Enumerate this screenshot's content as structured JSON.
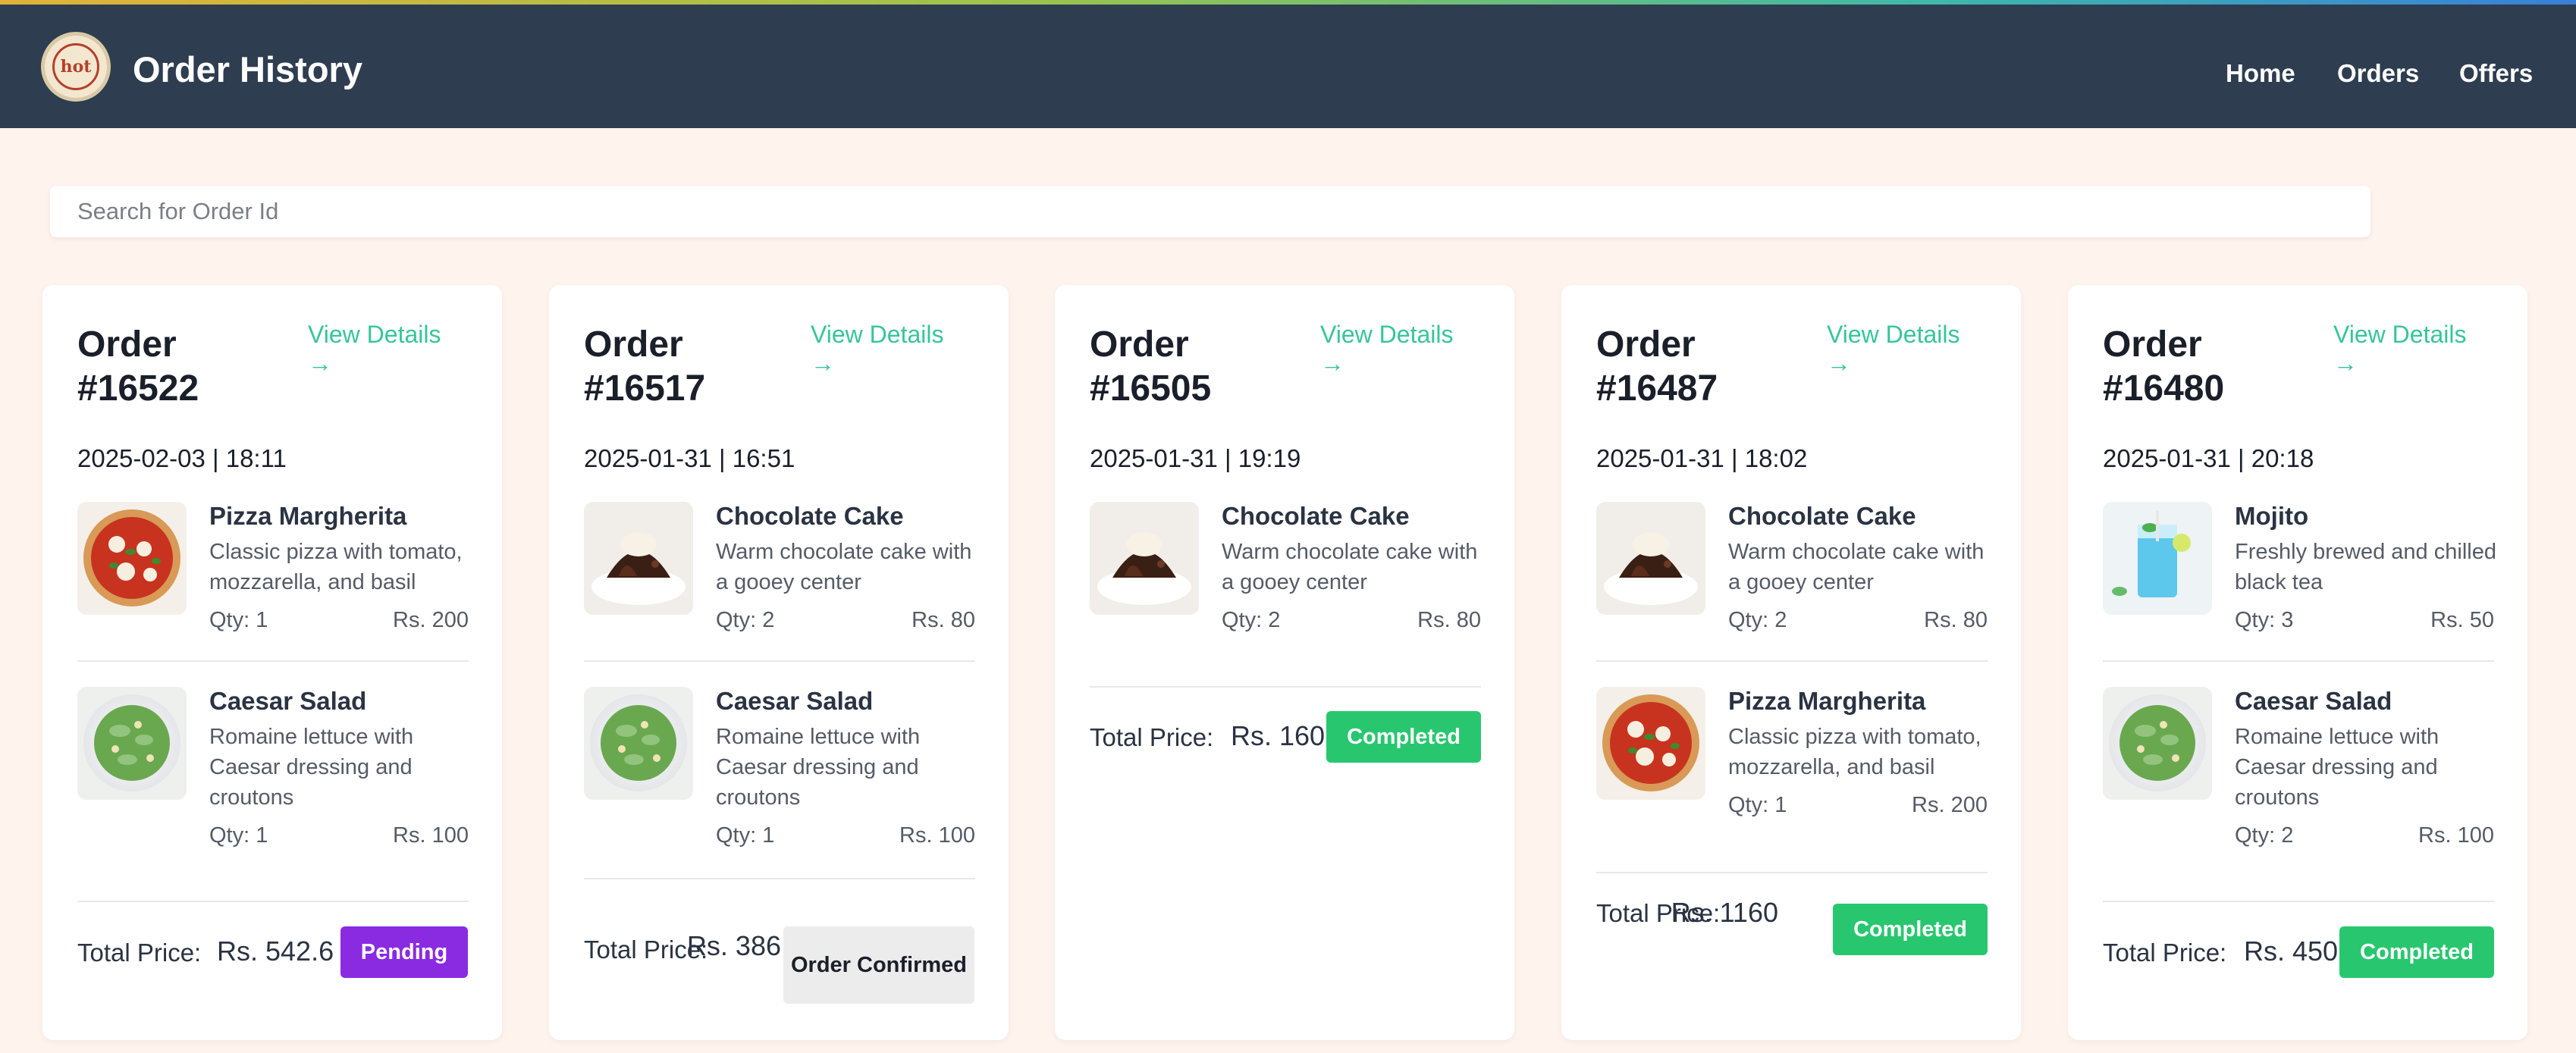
{
  "header": {
    "title": "Order History",
    "logo_icon": "hotel-logo-icon",
    "logo_text": "hot",
    "nav": {
      "home": "Home",
      "orders": "Orders",
      "offers": "Offers"
    }
  },
  "search": {
    "placeholder": "Search for Order Id",
    "value": ""
  },
  "labels": {
    "view_details": "View Details",
    "arrow": "→",
    "total_price": "Total Price:"
  },
  "orders": [
    {
      "id": "Order #16522",
      "date": "2025-02-03 | 18:11",
      "items": [
        {
          "name": "Pizza Margherita",
          "desc": "Classic pizza with tomato, mozzarella, and basil",
          "qty": "Qty: 1",
          "price": "Rs. 200",
          "icon": "pizza-image"
        },
        {
          "name": "Caesar Salad",
          "desc": "Romaine lettuce with Caesar dressing and croutons",
          "qty": "Qty: 1",
          "price": "Rs. 100",
          "icon": "salad-image"
        }
      ],
      "total": "Rs. 542.6",
      "status": "Pending",
      "status_color": "#8a2be2"
    },
    {
      "id": "Order #16517",
      "date": "2025-01-31 | 16:51",
      "items": [
        {
          "name": "Chocolate Cake",
          "desc": "Warm chocolate cake with a gooey center",
          "qty": "Qty: 2",
          "price": "Rs. 80",
          "icon": "cake-image"
        },
        {
          "name": "Caesar Salad",
          "desc": "Romaine lettuce with Caesar dressing and croutons",
          "qty": "Qty: 1",
          "price": "Rs. 100",
          "icon": "salad-image"
        }
      ],
      "total": "Rs. 386",
      "status": "Order Confirmed",
      "status_color": "#ececec"
    },
    {
      "id": "Order #16505",
      "date": "2025-01-31 | 19:19",
      "items": [
        {
          "name": "Chocolate Cake",
          "desc": "Warm chocolate cake with a gooey center",
          "qty": "Qty: 2",
          "price": "Rs. 80",
          "icon": "cake-image"
        }
      ],
      "total": "Rs. 160",
      "status": "Completed",
      "status_color": "#28c76f"
    },
    {
      "id": "Order #16487",
      "date": "2025-01-31 | 18:02",
      "items": [
        {
          "name": "Chocolate Cake",
          "desc": "Warm chocolate cake with a gooey center",
          "qty": "Qty: 2",
          "price": "Rs. 80",
          "icon": "cake-image"
        },
        {
          "name": "Pizza Margherita",
          "desc": "Classic pizza with tomato, mozzarella, and basil",
          "qty": "Qty: 1",
          "price": "Rs. 200",
          "icon": "pizza-image"
        }
      ],
      "total": "Rs. 1160",
      "status": "Completed",
      "status_color": "#28c76f"
    },
    {
      "id": "Order #16480",
      "date": "2025-01-31 | 20:18",
      "items": [
        {
          "name": "Mojito",
          "desc": "Freshly brewed and chilled black tea",
          "qty": "Qty: 3",
          "price": "Rs. 50",
          "icon": "mojito-image"
        },
        {
          "name": "Caesar Salad",
          "desc": "Romaine lettuce with Caesar dressing and croutons",
          "qty": "Qty: 2",
          "price": "Rs. 100",
          "icon": "salad-image"
        }
      ],
      "total": "Rs. 450",
      "status": "Completed",
      "status_color": "#28c76f"
    }
  ],
  "colors": {
    "navbar": "#2e3d50",
    "accent": "#36c59a",
    "background": "#fff3ee"
  }
}
